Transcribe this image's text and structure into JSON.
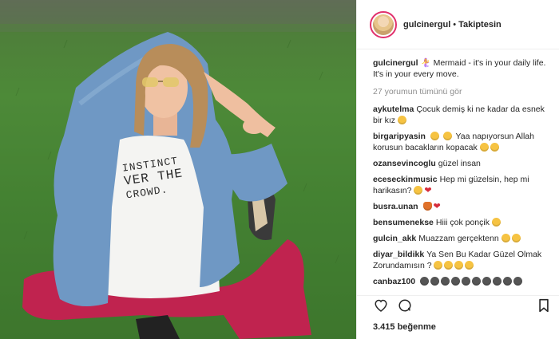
{
  "header": {
    "username": "gulcinergul",
    "separator": "•",
    "follow_status": "Takiptesin"
  },
  "caption": {
    "username": "gulcinergul",
    "text": "🧜‍♀️ Mermaid - it's in your daily life. It's in your every move."
  },
  "view_all": "27 yorumun tümünü gör",
  "comments": [
    {
      "username": "aykutelma",
      "text": "Çocuk demiş ki ne kadar da esnek bir kız"
    },
    {
      "username": "birgaripyasin",
      "text": "Yaa napıyorsun Allah korusun bacakların kopacak"
    },
    {
      "username": "ozansevincoglu",
      "text": "güzel insan"
    },
    {
      "username": "eceseckinmusic",
      "text": "Hep mi güzelsin, hep mi harikasın?"
    },
    {
      "username": "busra.unan",
      "text": ""
    },
    {
      "username": "bensumenekse",
      "text": "Hiii çok ponçik"
    },
    {
      "username": "gulcin_akk",
      "text": "Muazzam gerçektenn"
    },
    {
      "username": "diyar_bildikk",
      "text": "Ya Sen Bu Kadar Güzel Olmak Zorundamısın ?"
    },
    {
      "username": "canbaz100",
      "text": ""
    }
  ],
  "photo": {
    "shirt_text": [
      "INSTINCT",
      "VER THE",
      "CROWD."
    ]
  },
  "actions": {
    "like_icon": "heart-icon",
    "comment_icon": "comment-icon",
    "save_icon": "bookmark-icon"
  },
  "likes": "3.415 beğenme",
  "colors": {
    "accent": "#e1306c",
    "muted": "#8e8e8e",
    "text": "#262626"
  }
}
